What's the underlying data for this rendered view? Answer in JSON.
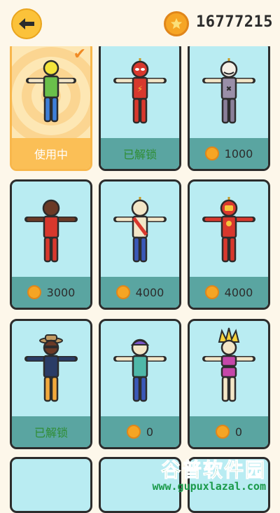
{
  "header": {
    "coins": "16777215"
  },
  "skins": [
    {
      "status": "使用中"
    },
    {
      "status": "已解锁"
    },
    {
      "price": "1000"
    },
    {
      "price": "3000"
    },
    {
      "price": "4000"
    },
    {
      "price": "4000"
    },
    {
      "status": "已解锁"
    },
    {
      "price": "0"
    },
    {
      "price": "0"
    }
  ],
  "watermark": {
    "title": "谷普软件园",
    "url": "www.gupuxlazal.com"
  },
  "colors": {
    "card_bg": "#b9ecf2",
    "bar_bg": "#5aa5a1",
    "coin": "#f6a524",
    "selected": "#fbbf56",
    "owned_text": "#2f8d34"
  }
}
